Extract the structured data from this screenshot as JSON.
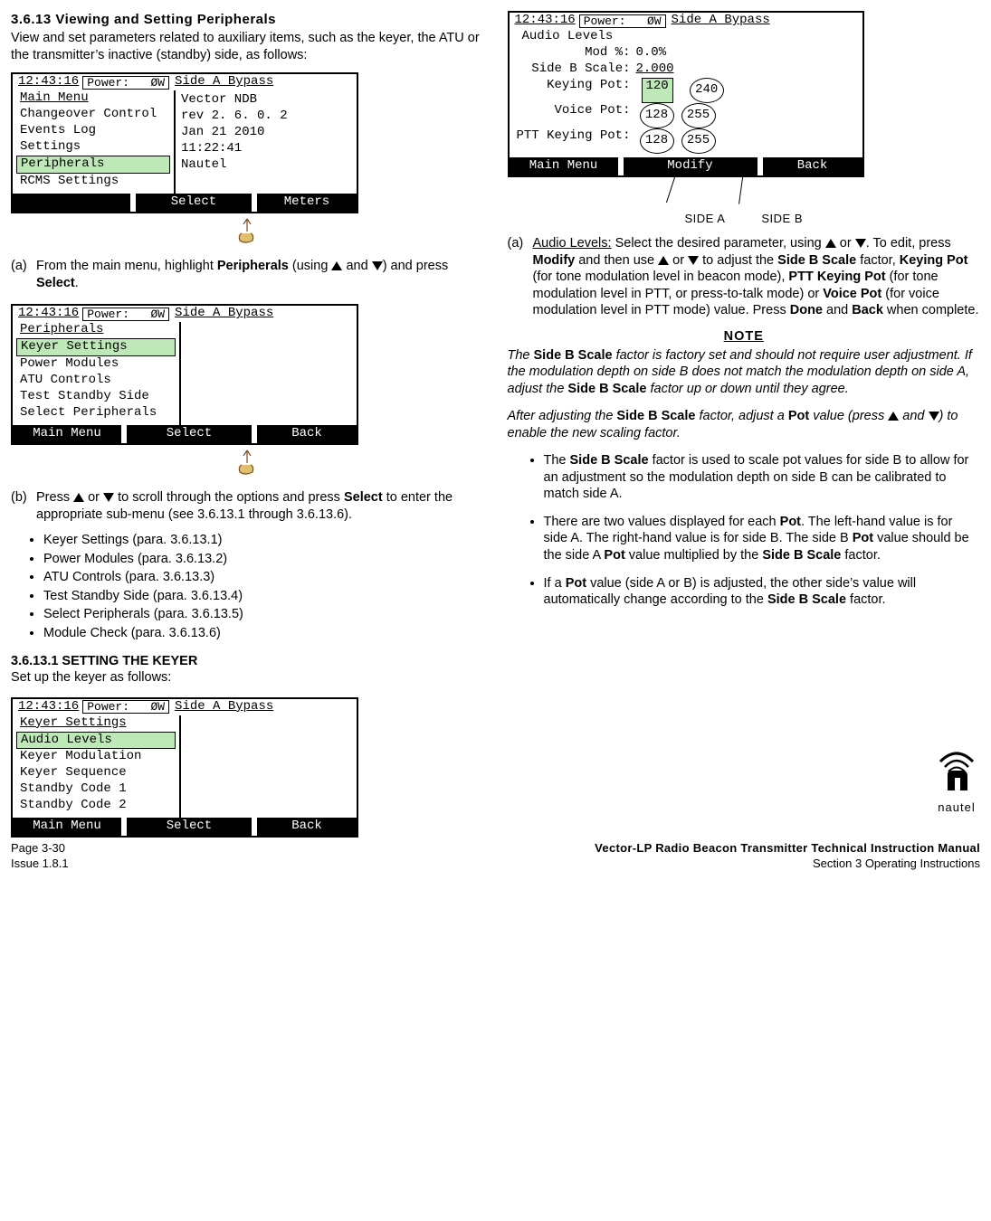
{
  "section": {
    "number": "3.6.13",
    "title": "Viewing and Setting Peripherals",
    "intro": "View and set parameters related to auxiliary items, such as the keyer, the ATU or the transmitter’s inactive (standby) side, as follows:"
  },
  "lcd_common": {
    "time": "12:43:16",
    "power_label": "Power:",
    "power_value": "ØW",
    "side_status": "Side A Bypass"
  },
  "lcd1": {
    "title": "Main Menu",
    "items": [
      "Changeover Control",
      "Events Log",
      "Settings",
      "Peripherals",
      "RCMS Settings"
    ],
    "highlight": "Peripherals",
    "info": [
      "Vector NDB",
      "rev  2. 6.  0.  2",
      "Jan 21 2010",
      "11:22:41",
      "Nautel"
    ],
    "foot_center": "Select",
    "foot_right": "Meters"
  },
  "lcd2": {
    "title": "Peripherals",
    "items": [
      "Keyer Settings",
      "Power Modules",
      "ATU Controls",
      "Test Standby Side",
      "Select Peripherals"
    ],
    "highlight": "Keyer Settings",
    "foot_left": "Main Menu",
    "foot_center": "Select",
    "foot_right": "Back"
  },
  "lcd3": {
    "title": "Keyer Settings",
    "items": [
      "Audio Levels",
      "Keyer Modulation",
      "Keyer Sequence",
      "Standby Code 1",
      "Standby Code 2"
    ],
    "highlight": "Audio Levels",
    "foot_left": "Main Menu",
    "foot_center": "Select",
    "foot_right": "Back"
  },
  "lcd4": {
    "title": "Audio Levels",
    "rows": [
      {
        "k": "Mod %:",
        "v": "0.0%"
      },
      {
        "k": "Side B Scale:",
        "v": "2.000",
        "u": true
      },
      {
        "k": "Keying Pot:",
        "a": "120",
        "b": "240",
        "hl": true
      },
      {
        "k": "Voice Pot:",
        "a": "128",
        "b": "255"
      },
      {
        "k": "PTT Keying Pot:",
        "a": "128",
        "b": "255"
      }
    ],
    "foot_left": "Main Menu",
    "foot_center": "Modify",
    "foot_right": "Back",
    "label_a": "SIDE A",
    "label_b": "SIDE B"
  },
  "step_a": {
    "label": "(a)",
    "text_before": "From the main menu, highlight ",
    "bold1": "Peripherals",
    "mid": " (using ",
    "mid2": " and ",
    "mid3": ") and press ",
    "bold2": "Select",
    "tail": "."
  },
  "step_b": {
    "label": "(b)",
    "t1": "Press ",
    "t2": " or ",
    "t3": " to scroll through the options and press ",
    "bold": "Select",
    "t4": " to enter the appropriate sub-menu (see 3.6.13.1 through 3.6.13.6)."
  },
  "sub_list": [
    "Keyer Settings (para. 3.6.13.1)",
    "Power Modules (para. 3.6.13.2)",
    "ATU Controls (para. 3.6.13.3)",
    "Test Standby Side (para. 3.6.13.4)",
    "Select Peripherals (para. 3.6.13.5)",
    "Module Check (para. 3.6.13.6)"
  ],
  "subsection1": {
    "head": "3.6.13.1 SETTING THE KEYER",
    "text": "Set up the keyer as follows:"
  },
  "r_step_a": {
    "label": "(a)",
    "lead_u": "Audio Levels:",
    "t1": " Select the desired parameter, using ",
    "t2": " or ",
    "t3": ". To edit, press ",
    "b1": "Modify",
    "t4": " and then use ",
    "t5": " or ",
    "t6": " to adjust the ",
    "b2": "Side B Scale",
    "t7": " factor, ",
    "b3": "Keying Pot",
    "t8": " (for tone modulation level in beacon mode), ",
    "b4": "PTT Keying Pot",
    "t9": " (for tone modulation level in PTT, or press-to-talk mode) or ",
    "b5": "Voice Pot",
    "t10": " (for voice modulation level in PTT mode) value. Press ",
    "b6": "Done",
    "t11": " and ",
    "b7": "Back",
    "t12": " when complete."
  },
  "note_label": "NOTE",
  "note1": {
    "t1": "The ",
    "b1": "Side B Scale",
    "t2": " factor is factory set and should not require user adjustment. If the modulation depth on side B does not match the modulation depth on side A, adjust the ",
    "b2": "Side B Scale",
    "t3": " factor up or down until they agree."
  },
  "note2": {
    "t1": "After adjusting the ",
    "b1": "Side B Scale",
    "t2": " factor, adjust a ",
    "b2": "Pot",
    "t3": " value (press ",
    "t4": " and ",
    "t5": ") to enable the new scaling factor."
  },
  "bul_right": {
    "i1": {
      "t1": "The ",
      "b1": "Side B Scale",
      "t2": " factor is used to scale pot values for side B to allow for an adjustment so the modulation depth on side B can be calibrated to match side A."
    },
    "i2": {
      "t1": "There are two values displayed for each ",
      "b1": "Pot",
      "t2": ". The left-hand value is for side A. The right-hand value is for side B. The side B ",
      "b2": "Pot",
      "t3": " value should be the side A ",
      "b3": "Pot",
      "t4": " value multiplied by the ",
      "b4": "Side B Scale",
      "t5": " factor."
    },
    "i3": {
      "t1": "If a ",
      "b1": "Pot",
      "t2": " value (side A or B) is adjusted, the other side’s value will automatically change according to the ",
      "b2": "Side B Scale",
      "t3": " factor."
    }
  },
  "footer": {
    "left1": "Page 3-30",
    "left2": "Issue 1.8.1",
    "right1": "Vector-LP Radio Beacon Transmitter Technical Instruction Manual",
    "right2": "Section 3  Operating Instructions"
  },
  "logo_text": "nautel"
}
